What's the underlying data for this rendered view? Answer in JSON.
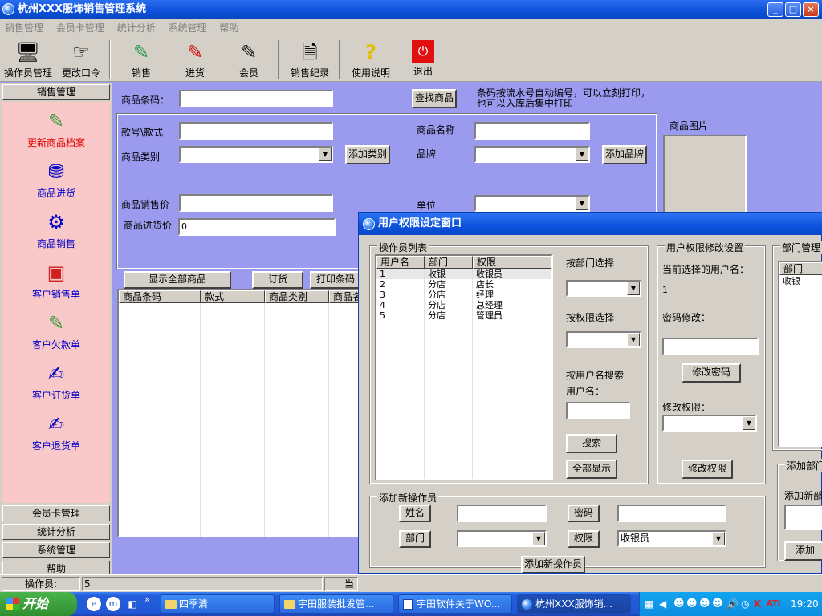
{
  "window": {
    "title": "杭州XXX服饰销售管理系统",
    "min": "_",
    "max": "□",
    "close": "×"
  },
  "menu": [
    "销售管理",
    "会员卡管理",
    "统计分析",
    "系统管理",
    "帮助"
  ],
  "toolbar": [
    {
      "label": "操作员管理",
      "icon": "operator-icon"
    },
    {
      "label": "更改口令",
      "icon": "key-icon"
    },
    {
      "label": "销售",
      "icon": "pen-green-icon"
    },
    {
      "label": "进货",
      "icon": "pen-red-icon"
    },
    {
      "label": "会员",
      "icon": "pen-black-icon"
    },
    {
      "label": "销售纪录",
      "icon": "record-icon"
    },
    {
      "label": "使用说明",
      "icon": "help-icon"
    },
    {
      "label": "退出",
      "icon": "exit-icon"
    }
  ],
  "sidebar": {
    "top": "销售管理",
    "items": [
      "更新商品档案",
      "商品进货",
      "商品销售",
      "客户销售单",
      "客户欠款单",
      "客户订货单",
      "客户退货单"
    ],
    "bottom": [
      "会员卡管理",
      "统计分析",
      "系统管理",
      "帮助"
    ]
  },
  "form": {
    "barcode_label": "商品条码：",
    "find_btn": "查找商品",
    "hint": "条码按流水号自动编号，可以立刻打印，也可以入库后集中打印",
    "style_label": "款号\\款式",
    "name_label": "商品名称",
    "category_label": "商品类别",
    "add_category": "添加类别",
    "brand_label": "品牌",
    "add_brand": "添加品牌",
    "price_label": "商品销售价",
    "unit_label": "单位",
    "cost_label": "商品进货价",
    "cost_value": "0",
    "image_label": "商品图片",
    "show_all": "显示全部商品",
    "order": "订货",
    "print": "打印条码",
    "cols": [
      "商品条码",
      "款式",
      "商品类别",
      "商品名"
    ]
  },
  "status": {
    "operator_label": "操作员:",
    "operator_value": "5",
    "current": "当前"
  },
  "dialog": {
    "title": "用户权限设定窗口",
    "list_group": "操作员列表",
    "cols": [
      "用户名",
      "部门",
      "权限"
    ],
    "rows": [
      [
        "1",
        "收银",
        "收银员"
      ],
      [
        "2",
        "分店",
        "店长"
      ],
      [
        "3",
        "分店",
        "经理"
      ],
      [
        "4",
        "分店",
        "总经理"
      ],
      [
        "5",
        "分店",
        "管理员"
      ]
    ],
    "dept_select": "按部门选择",
    "perm_select": "按权限选择",
    "search_label": "按用户名搜索",
    "username_label": "用户名：",
    "search_btn": "搜索",
    "show_all_btn": "全部显示",
    "modify_group": "用户权限修改设置",
    "current_user_label": "当前选择的用户名：",
    "current_user": "1",
    "pwd_modify": "密码修改：",
    "pwd_btn": "修改密码",
    "perm_modify": "修改权限：",
    "perm_btn": "修改权限",
    "dept_group": "部门管理",
    "dept_col": "部门",
    "dept_rows": [
      "收银"
    ],
    "add_dept_group": "添加部门",
    "add_dept_label": "添加新部",
    "add_btn": "添加",
    "add_op_group": "添加新操作员",
    "name_label": "姓名",
    "pwd_label": "密码",
    "dept_label": "部门",
    "perm_label": "权限",
    "perm_value": "收银员",
    "add_op_btn": "添加新操作员"
  },
  "taskbar": {
    "start": "开始",
    "tasks": [
      "四季清",
      "宇田服装批发管...",
      "宇田软件关于WO...",
      "杭州XXX服饰销..."
    ],
    "time": "19:20"
  }
}
